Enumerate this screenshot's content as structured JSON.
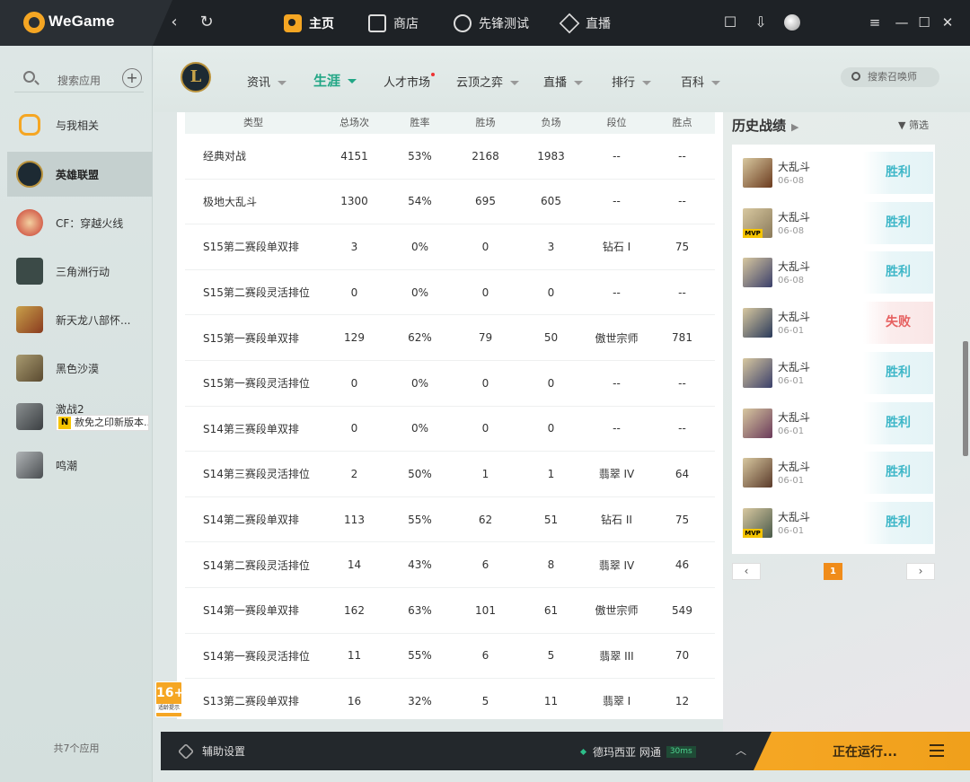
{
  "topbar": {
    "brand": "WeGame",
    "tabs": [
      {
        "label": "主页",
        "icon": "home-icon"
      },
      {
        "label": "商店",
        "icon": "shop-icon"
      },
      {
        "label": "先锋测试",
        "icon": "test-icon"
      },
      {
        "label": "直播",
        "icon": "live-icon"
      }
    ]
  },
  "sidebar": {
    "search_placeholder": "搜索应用",
    "items": [
      {
        "label": "与我相关",
        "color": "#f5a623"
      },
      {
        "label": "英雄联盟",
        "color": "#1d2a33"
      },
      {
        "label": "CF：穿越火线",
        "color": "#c8382e"
      },
      {
        "label": "三角洲行动",
        "color": "#2aa889"
      },
      {
        "label": "新天龙八部怀...",
        "color": "#8a3b1f"
      },
      {
        "label": "黑色沙漠",
        "color": "#7d6b4a"
      },
      {
        "label": "激战2",
        "color": "#555b5e"
      },
      {
        "label": "鸣潮",
        "color": "#6b6f72"
      }
    ],
    "badge_letter": "N",
    "badge_text": "赦免之印新版本...",
    "footer": "共7个应用"
  },
  "game_nav": {
    "logo_letter": "L",
    "tabs": [
      "资讯",
      "生涯",
      "人才市场",
      "云顶之弈",
      "直播",
      "排行",
      "百科"
    ],
    "search_placeholder": "搜索召唤师"
  },
  "table": {
    "headers": [
      "类型",
      "总场次",
      "胜率",
      "胜场",
      "负场",
      "段位",
      "胜点"
    ],
    "rows": [
      [
        "经典对战",
        "4151",
        "53%",
        "2168",
        "1983",
        "--",
        "--"
      ],
      [
        "极地大乱斗",
        "1300",
        "54%",
        "695",
        "605",
        "--",
        "--"
      ],
      [
        "S15第二赛段单双排",
        "3",
        "0%",
        "0",
        "3",
        "钻石 I",
        "75"
      ],
      [
        "S15第二赛段灵活排位",
        "0",
        "0%",
        "0",
        "0",
        "--",
        "--"
      ],
      [
        "S15第一赛段单双排",
        "129",
        "62%",
        "79",
        "50",
        "傲世宗师",
        "781"
      ],
      [
        "S15第一赛段灵活排位",
        "0",
        "0%",
        "0",
        "0",
        "--",
        "--"
      ],
      [
        "S14第三赛段单双排",
        "0",
        "0%",
        "0",
        "0",
        "--",
        "--"
      ],
      [
        "S14第三赛段灵活排位",
        "2",
        "50%",
        "1",
        "1",
        "翡翠 IV",
        "64"
      ],
      [
        "S14第二赛段单双排",
        "113",
        "55%",
        "62",
        "51",
        "钻石 II",
        "75"
      ],
      [
        "S14第二赛段灵活排位",
        "14",
        "43%",
        "6",
        "8",
        "翡翠 IV",
        "46"
      ],
      [
        "S14第一赛段单双排",
        "162",
        "63%",
        "101",
        "61",
        "傲世宗师",
        "549"
      ],
      [
        "S14第一赛段灵活排位",
        "11",
        "55%",
        "6",
        "5",
        "翡翠 III",
        "70"
      ],
      [
        "S13第二赛段单双排",
        "16",
        "32%",
        "5",
        "11",
        "翡翠 I",
        "12"
      ]
    ]
  },
  "age_rating": {
    "num": "16+",
    "text": "适龄提示"
  },
  "history": {
    "title": "历史战绩",
    "filter": "筛选",
    "mvp_label": "MVP",
    "items": [
      {
        "mode": "大乱斗",
        "date": "06-08",
        "result": "胜利",
        "win": true,
        "mvp": false,
        "color": "#6b3b1e"
      },
      {
        "mode": "大乱斗",
        "date": "06-08",
        "result": "胜利",
        "win": true,
        "mvp": true,
        "color": "#8a7a5a"
      },
      {
        "mode": "大乱斗",
        "date": "06-08",
        "result": "胜利",
        "win": true,
        "mvp": false,
        "color": "#3a3f6a"
      },
      {
        "mode": "大乱斗",
        "date": "06-01",
        "result": "失败",
        "win": false,
        "mvp": false,
        "color": "#2a3a5a"
      },
      {
        "mode": "大乱斗",
        "date": "06-01",
        "result": "胜利",
        "win": true,
        "mvp": false,
        "color": "#3a3f6a"
      },
      {
        "mode": "大乱斗",
        "date": "06-01",
        "result": "胜利",
        "win": true,
        "mvp": false,
        "color": "#6a3a5a"
      },
      {
        "mode": "大乱斗",
        "date": "06-01",
        "result": "胜利",
        "win": true,
        "mvp": false,
        "color": "#5a3a2a"
      },
      {
        "mode": "大乱斗",
        "date": "06-01",
        "result": "胜利",
        "win": true,
        "mvp": true,
        "color": "#4a5a4a"
      }
    ],
    "page": "1"
  },
  "bottombar": {
    "settings": "辅助设置",
    "server": "德玛西亚 网通",
    "ping": "30ms",
    "running": "正在运行..."
  }
}
